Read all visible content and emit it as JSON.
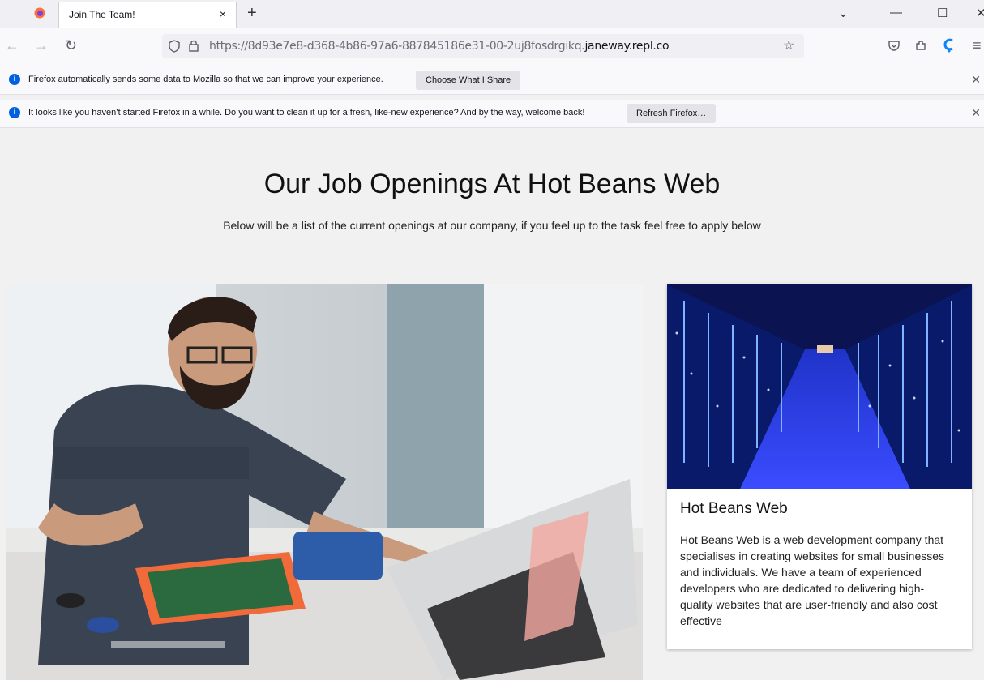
{
  "browser": {
    "tab_title": "Join The Team!",
    "tab_close": "×",
    "new_tab": "+",
    "url_prefix": "https://8d93e7e8-d368-4b86-97a6-887845186e31-00-2uj8fosdrgikq.",
    "url_host": "janeway.repl.co",
    "icons": [
      "firefox-icon",
      "back-icon",
      "forward-icon",
      "reload-icon",
      "shield-icon",
      "lock-icon",
      "bookmark-star-icon",
      "pocket-icon",
      "extensions-icon",
      "account-icon",
      "menu-icon"
    ]
  },
  "notifications": [
    {
      "text": "Firefox automatically sends some data to Mozilla so that we can improve your experience.",
      "button": "Choose What I Share"
    },
    {
      "text": "It looks like you haven’t started Firefox in a while. Do you want to clean it up for a fresh, like-new experience? And by the way, welcome back!",
      "button": "Refresh Firefox…"
    }
  ],
  "page": {
    "title": "Our Job Openings At Hot Beans Web",
    "subtitle": "Below will be a list of the current openings at our company, if you feel up to the task feel free to apply below"
  },
  "card": {
    "title": "Hot Beans Web",
    "body": "Hot Beans Web is a web development company that specialises in creating websites for small businesses and individuals. We have a team of experienced developers who are dedicated to delivering high-quality websites that are user-friendly and also cost effective"
  },
  "colors": {
    "page_bg": "#f1f1f1",
    "info_blue": "#0060df",
    "card_bg": "#ffffff"
  }
}
